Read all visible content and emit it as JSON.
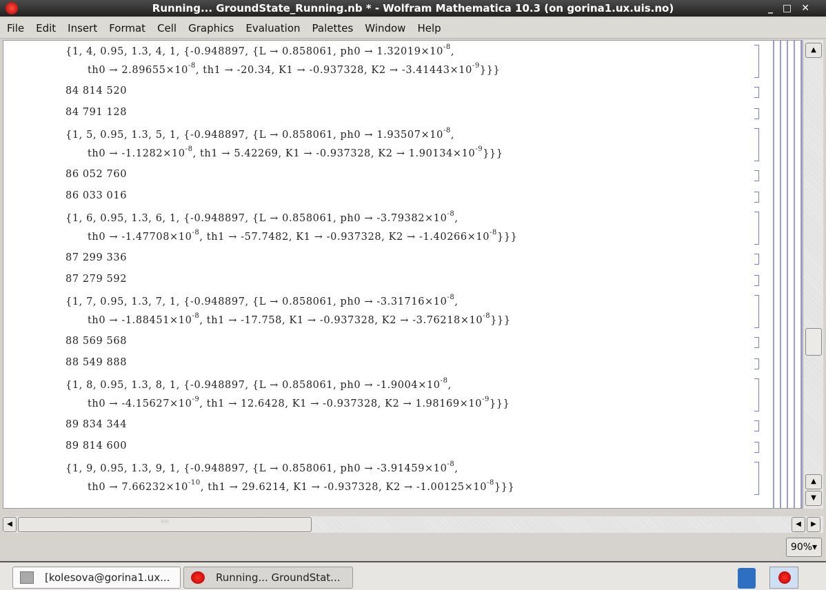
{
  "window": {
    "title": "Running... GroundState_Running.nb * - Wolfram Mathematica 10.3 (on gorina1.ux.uis.no)",
    "controls": [
      "_",
      "□",
      "✕"
    ]
  },
  "menu": [
    "File",
    "Edit",
    "Insert",
    "Format",
    "Cell",
    "Graphics",
    "Evaluation",
    "Palettes",
    "Window",
    "Help"
  ],
  "cells": [
    {
      "type": "list",
      "head": "{1, 4, 0.95, 1.3, 4, 1, {-0.948897, {L → 0.858061, ph0 → ",
      "ph0": [
        "1.32019",
        "-8"
      ],
      "th0": [
        "2.89655",
        "-8"
      ],
      "th1": "-20.34",
      "K1": "-0.937328",
      "K2": [
        "-3.41443",
        "-9"
      ]
    },
    {
      "type": "num",
      "value": "84 814 520"
    },
    {
      "type": "num",
      "value": "84 791 128"
    },
    {
      "type": "list",
      "head": "{1, 5, 0.95, 1.3, 5, 1, {-0.948897, {L → 0.858061, ph0 → ",
      "ph0": [
        "1.93507",
        "-8"
      ],
      "th0": [
        "-1.1282",
        "-8"
      ],
      "th1": "5.42269",
      "K1": "-0.937328",
      "K2": [
        "1.90134",
        "-9"
      ]
    },
    {
      "type": "num",
      "value": "86 052 760"
    },
    {
      "type": "num",
      "value": "86 033 016"
    },
    {
      "type": "list",
      "head": "{1, 6, 0.95, 1.3, 6, 1, {-0.948897, {L → 0.858061, ph0 → ",
      "ph0": [
        "-3.79382",
        "-8"
      ],
      "th0": [
        "-1.47708",
        "-8"
      ],
      "th1": "-57.7482",
      "K1": "-0.937328",
      "K2": [
        "-1.40266",
        "-8"
      ]
    },
    {
      "type": "num",
      "value": "87 299 336"
    },
    {
      "type": "num",
      "value": "87 279 592"
    },
    {
      "type": "list",
      "head": "{1, 7, 0.95, 1.3, 7, 1, {-0.948897, {L → 0.858061, ph0 → ",
      "ph0": [
        "-3.31716",
        "-8"
      ],
      "th0": [
        "-1.88451",
        "-8"
      ],
      "th1": "-17.758",
      "K1": "-0.937328",
      "K2": [
        "-3.76218",
        "-8"
      ]
    },
    {
      "type": "num",
      "value": "88 569 568"
    },
    {
      "type": "num",
      "value": "88 549 888"
    },
    {
      "type": "list",
      "head": "{1, 8, 0.95, 1.3, 8, 1, {-0.948897, {L → 0.858061, ph0 → ",
      "ph0": [
        "-1.9004",
        "-8"
      ],
      "th0": [
        "-4.15627",
        "-9"
      ],
      "th1": "12.6428",
      "K1": "-0.937328",
      "K2": [
        "1.98169",
        "-9"
      ]
    },
    {
      "type": "num",
      "value": "89 834 344"
    },
    {
      "type": "num",
      "value": "89 814 600"
    },
    {
      "type": "list",
      "head": "{1, 9, 0.95, 1.3, 9, 1, {-0.948897, {L → 0.858061, ph0 → ",
      "ph0": [
        "-3.91459",
        "-8"
      ],
      "th0": [
        "7.66232",
        "-10"
      ],
      "th1": "29.6214",
      "K1": "-0.937328",
      "K2": [
        "-1.00125",
        "-8"
      ]
    }
  ],
  "zoom": "90%",
  "taskbar": [
    {
      "label": "[kolesova@gorina1.ux..."
    },
    {
      "label": "Running... GroundStat..."
    }
  ],
  "colors": {
    "bracket": "#7a7ad8",
    "accent": "#cc0000"
  }
}
